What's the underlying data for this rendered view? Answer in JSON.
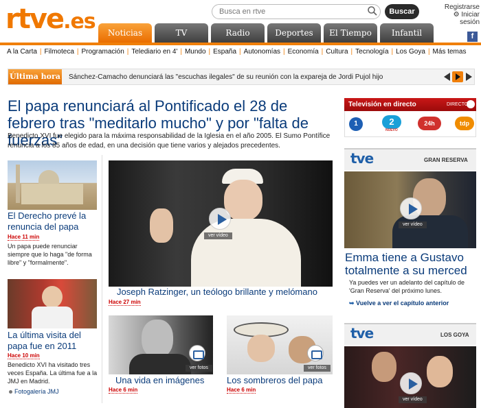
{
  "header": {
    "logo_main": "rtve",
    "logo_suffix": ".es",
    "search_placeholder": "Busca en rtve",
    "search_button": "Buscar",
    "register": "Registrarse",
    "login": "Iniciar sesión"
  },
  "nav": {
    "tabs": [
      {
        "label": "Noticias",
        "active": true
      },
      {
        "label": "TV"
      },
      {
        "label": "Radio"
      },
      {
        "label": "Deportes"
      },
      {
        "label": "El Tiempo"
      },
      {
        "label": "Infantil"
      }
    ],
    "facebook": "f"
  },
  "subnav": [
    "A la Carta",
    "Filmoteca",
    "Programación",
    "Telediario en 4'",
    "Mundo",
    "España",
    "Autonomías",
    "Economía",
    "Cultura",
    "Tecnología",
    "Los Goya",
    "Más temas"
  ],
  "ultima_hora": {
    "label": "Última hora",
    "text": "Sánchez-Camacho denunciará las \"escuchas ilegales\" de su reunión con la expareja de Jordi Pujol hijo"
  },
  "main": {
    "headline": "El papa renunciará al Pontificado el 28 de febrero tras \"meditarlo mucho\" y por \"falta de fuerzas\"",
    "lead": "Benedicto XVI fue elegido para la máxima responsabilidad de la Iglesia en el año 2005. El Sumo Pontífice renuncia a los 85 años de edad, en una decisión que tiene varios y alejados precedentes.",
    "big_caption": "Joseph Ratzinger, un teólogo brillante y melómano",
    "big_time": "Hace 27 min",
    "ver_video": "ver vídeo",
    "ver_fotos": "ver fotos"
  },
  "left": [
    {
      "title": "El Derecho prevé la renuncia del papa",
      "time": "Hace 11 min",
      "text": "Un papa puede renunciar siempre que lo haga \"de forma libre\" y \"formalmente\"."
    },
    {
      "title": "La última visita del papa fue en 2011",
      "time": "Hace 10 min",
      "text": "Benedicto XVI ha visitado tres veces España. La última fue a la JMJ en Madrid."
    }
  ],
  "fotogaleria": "Fotogalería JMJ",
  "bottom": [
    {
      "title": "Una vida en imágenes",
      "time": "Hace 6 min"
    },
    {
      "title": "Los sombreros del papa",
      "time": "Hace 6 min"
    }
  ],
  "sidebar": {
    "tv_title": "Televisión en directo",
    "tv_directo": "DIRECTO",
    "channels": [
      {
        "label": "1",
        "color": "#1d5fb4"
      },
      {
        "label": "2",
        "sub": "NUEVO",
        "color": "#1aa0d8"
      },
      {
        "label": "24h",
        "color": "#d0312d"
      },
      {
        "label": "tdp",
        "color": "#f08c00"
      }
    ],
    "tve": "tve",
    "box1_label": "GRAN RESERVA",
    "box1_title": "Emma tiene a Gustavo totalmente a su merced",
    "box1_desc": "Ya puedes ver un adelanto del capítulo de 'Gran Reserva' del próximo lunes.",
    "box1_link": "Vuelve a ver el capítulo anterior",
    "box2_label": "LOS GOYA"
  }
}
